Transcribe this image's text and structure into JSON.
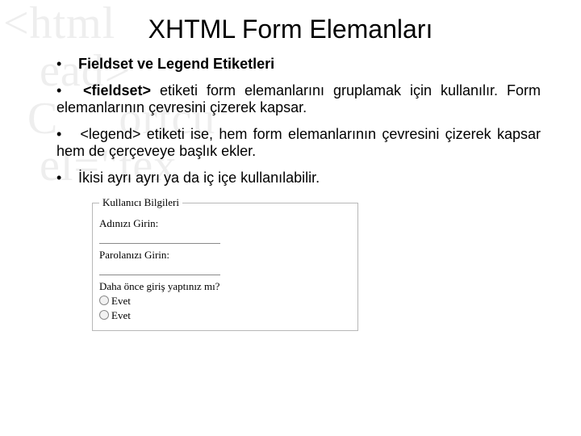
{
  "bg_lines": "<html\n   ead>\n  C     ortcu\n   el=\"tex",
  "title": "XHTML Form Elemanları",
  "bullets": {
    "b1": "Fieldset ve Legend Etiketleri",
    "b2_pre": "<fieldset>",
    "b2_rest": " etiketi form elemanlarını gruplamak için kullanılır. Form elemanlarının çevresini çizerek kapsar.",
    "b3": "<legend> etiketi ise, hem form elemanlarının çevresini çizerek kapsar hem de çerçeveye başlık ekler.",
    "b4": "İkisi ayrı ayrı ya da iç içe kullanılabilir."
  },
  "figure": {
    "legend": "Kullanıcı Bilgileri",
    "label_name": "Adınızı Girin:",
    "label_pass": "Parolanızı Girin:",
    "label_prev": "Daha önce giriş yaptınız mı?",
    "opt1": "Evet",
    "opt2": "Evet"
  }
}
